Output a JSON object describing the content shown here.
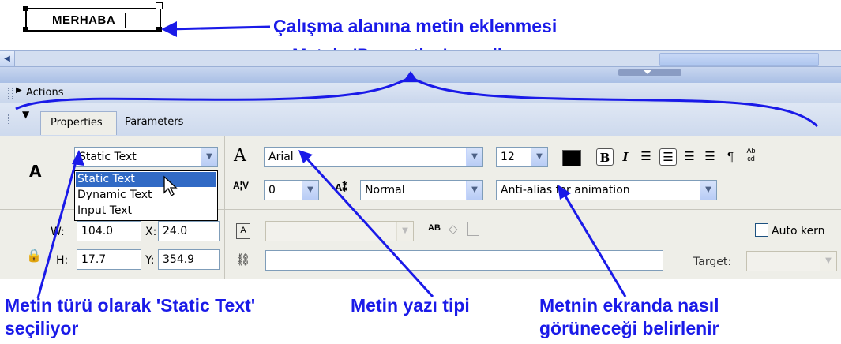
{
  "stage": {
    "text": "MERHABA"
  },
  "annotations": {
    "stage_note": "Çalışma alanına metin eklenmesi",
    "panel_note": "Metnin 'Properties' paneli",
    "type_note_line1": "Metin türü olarak 'Static Text'",
    "type_note_line2": "seçiliyor",
    "font_note": "Metin yazı tipi",
    "alias_note_line1": "Metnin ekranda nasıl",
    "alias_note_line2": "görüneceği belirlenir",
    "color": "#1a1ae8"
  },
  "actions_bar": {
    "label": "Actions"
  },
  "tabs": [
    {
      "label": "Properties"
    },
    {
      "label": "Parameters"
    }
  ],
  "properties": {
    "tool_glyph": "A",
    "text_type": {
      "selected": "Static Text",
      "options": [
        "Static Text",
        "Dynamic Text",
        "Input Text"
      ]
    },
    "font": {
      "value": "Arial"
    },
    "font_size": {
      "value": "12"
    },
    "letter_spacing": {
      "value": "0"
    },
    "char_position": {
      "value": "Normal"
    },
    "anti_alias": {
      "value": "Anti-alias for animation"
    },
    "width": {
      "label": "W:",
      "value": "104.0"
    },
    "height": {
      "label": "H:",
      "value": "17.7"
    },
    "x": {
      "label": "X:",
      "value": "24.0"
    },
    "y": {
      "label": "Y:",
      "value": "354.9"
    },
    "auto_kern": {
      "label": "Auto kern",
      "checked": false
    },
    "target": {
      "label": "Target:"
    },
    "fill_color": "#000000",
    "bold_glyph": "B",
    "italic_glyph": "I",
    "para_glyph": "¶"
  }
}
